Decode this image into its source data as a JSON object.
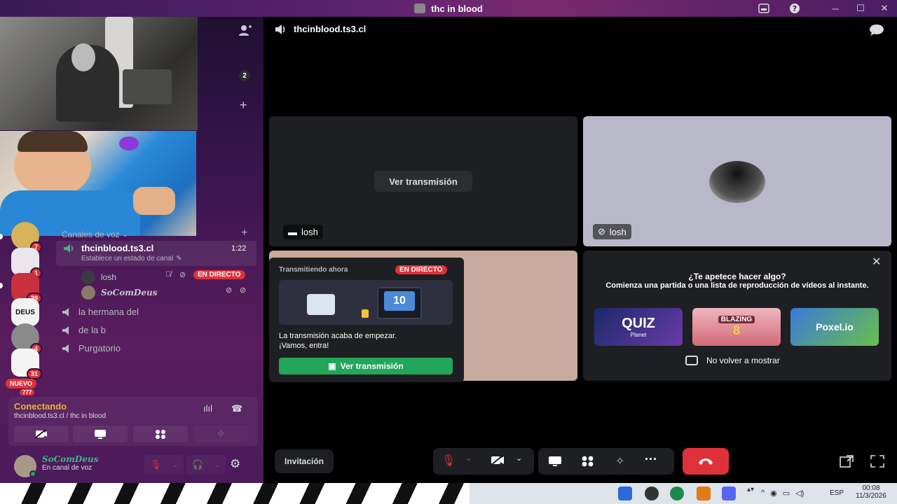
{
  "window": {
    "title": "thc in blood"
  },
  "sidebar": {
    "voice_count_badge": "2",
    "servers": [
      {
        "badge": "7"
      },
      {
        "badge": "1"
      },
      {
        "badge": "29"
      },
      {
        "label": "DEUS"
      },
      {
        "badge": "4"
      },
      {
        "badge": "31"
      }
    ],
    "new_label": "NUEVO",
    "new_count": "777",
    "voice_header": "Canales de voz",
    "active_channel": {
      "name": "thcinblood.ts3.cl",
      "time": "1:22",
      "status_placeholder": "Establece un estado de canal"
    },
    "members": [
      {
        "name": "losh",
        "live": "EN DIRECTO"
      },
      {
        "name": "SoComDeus"
      }
    ],
    "channels": [
      "la hermana del",
      "de la b",
      "Purgatorio"
    ],
    "connection": {
      "status": "Conectando",
      "detail": "thcinblood.ts3.cl / thc in blood"
    },
    "user": {
      "name": "SoComDeus",
      "status": "En canal de voz"
    }
  },
  "main": {
    "header": {
      "channel_name": "thcinblood.ts3.cl"
    },
    "tiles": [
      {
        "button": "Ver transmisión",
        "name": "losh"
      },
      {
        "name": "losh"
      }
    ],
    "stream_popup": {
      "title": "Transmitiendo ahora",
      "live": "EN DIRECTO",
      "message_line1": "La transmisión acaba de empezar.",
      "message_line2": "¡Vamos, entra!",
      "button": "Ver transmisión"
    },
    "activity": {
      "title": "¿Te apetece hacer algo?",
      "subtitle": "Comienza una partida o una lista de reproducción de vídeos al instante.",
      "games": [
        {
          "name": "QUIZ",
          "sub": "Planet"
        },
        {
          "name": "BLAZING",
          "sub": "8"
        },
        {
          "name": "Poxel.io"
        }
      ],
      "checkbox_label": "No volver a mostrar"
    },
    "controls": {
      "invite_label": "Invitación"
    }
  },
  "taskbar": {
    "lang": "ESP",
    "time": "00:08",
    "date": "11/3/2026"
  }
}
